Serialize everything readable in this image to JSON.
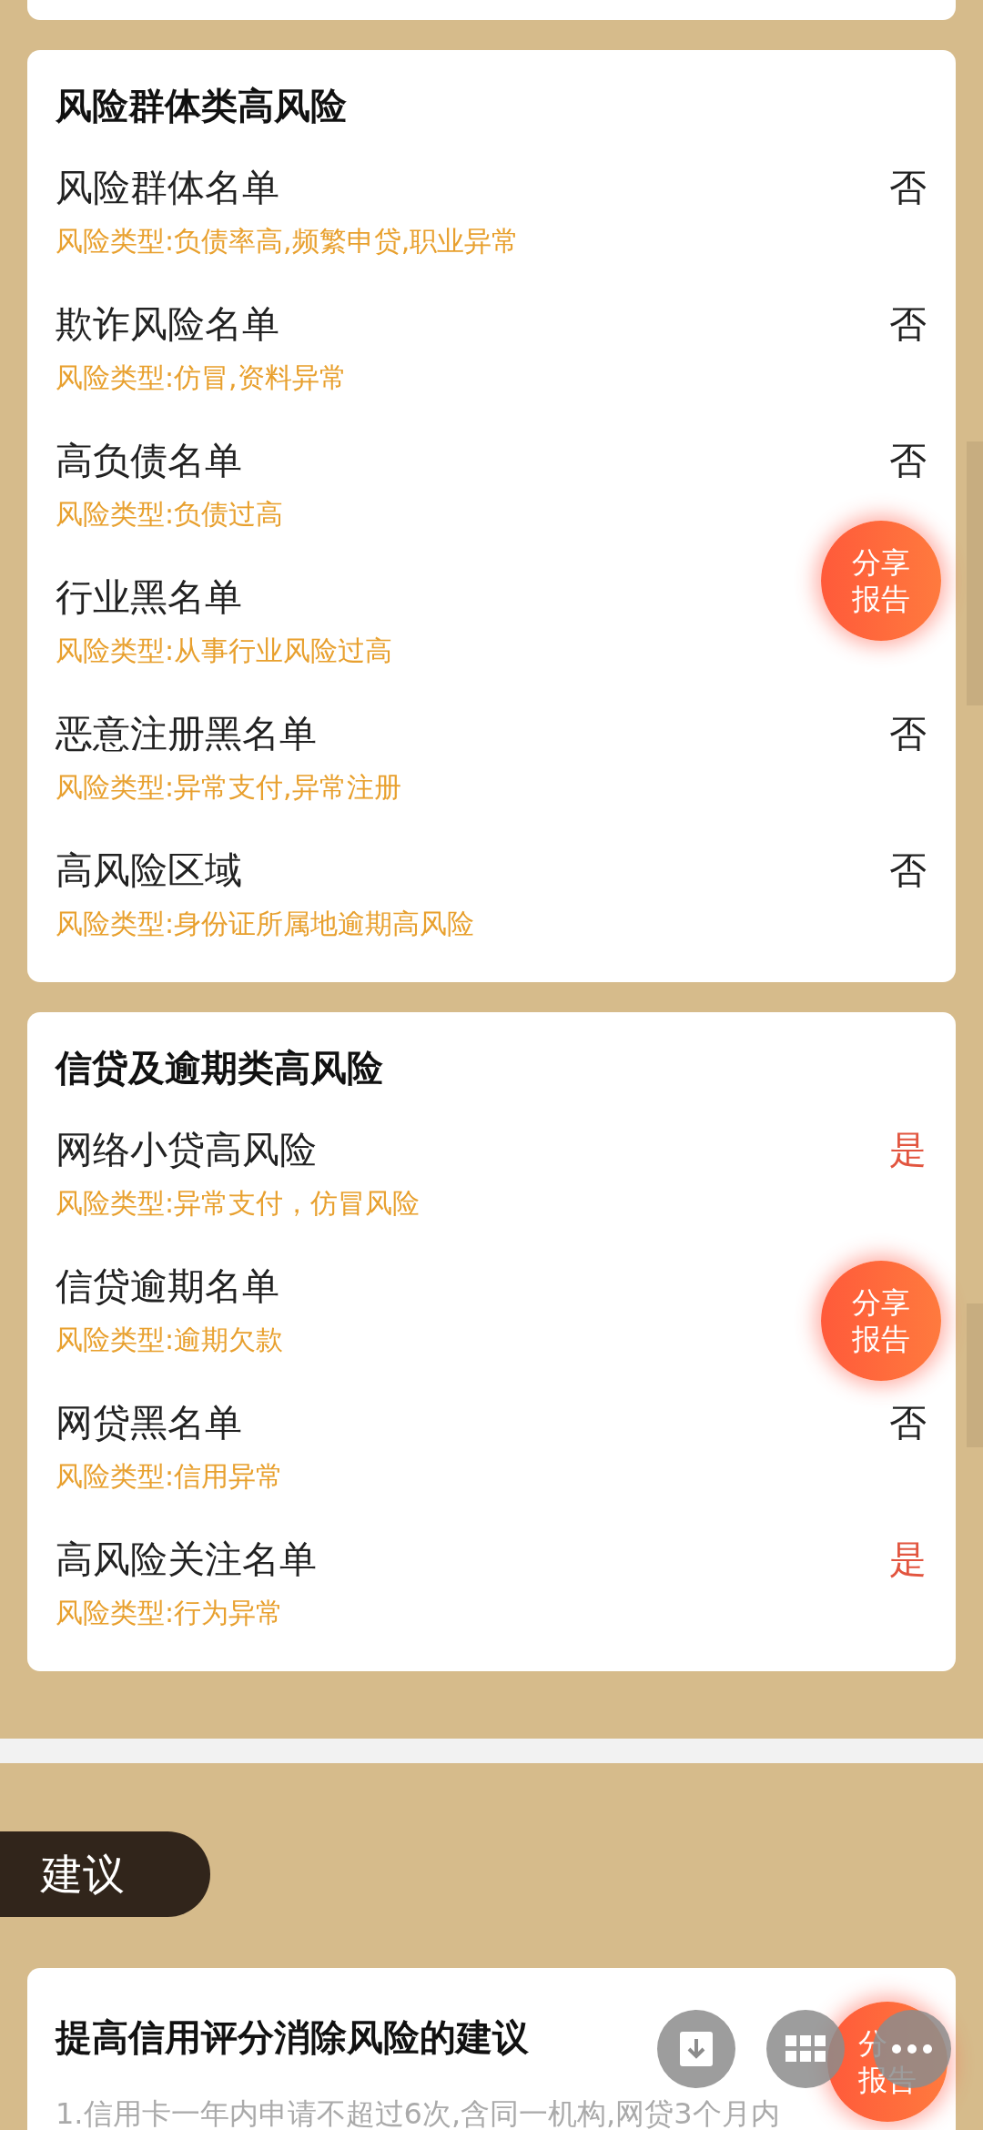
{
  "sections": [
    {
      "title": "风险群体类高风险",
      "items": [
        {
          "name": "风险群体名单",
          "risk_type": "风险类型:负债率高,频繁申贷,职业异常",
          "value": "否",
          "flagged": false
        },
        {
          "name": "欺诈风险名单",
          "risk_type": "风险类型:仿冒,资料异常",
          "value": "否",
          "flagged": false
        },
        {
          "name": "高负债名单",
          "risk_type": "风险类型:负债过高",
          "value": "否",
          "flagged": false
        },
        {
          "name": "行业黑名单",
          "risk_type": "风险类型:从事行业风险过高"
        },
        {
          "name": "恶意注册黑名单",
          "risk_type": "风险类型:异常支付,异常注册",
          "value": "否",
          "flagged": false
        },
        {
          "name": "高风险区域",
          "risk_type": "风险类型:身份证所属地逾期高风险",
          "value": "否",
          "flagged": false
        }
      ]
    },
    {
      "title": "信贷及逾期类高风险",
      "items": [
        {
          "name": "网络小贷高风险",
          "risk_type": "风险类型:异常支付，仿冒风险",
          "value": "是",
          "flagged": true
        },
        {
          "name": "信贷逾期名单",
          "risk_type": "风险类型:逾期欠款"
        },
        {
          "name": "网贷黑名单",
          "risk_type": "风险类型:信用异常",
          "value": "否",
          "flagged": false
        },
        {
          "name": "高风险关注名单",
          "risk_type": "风险类型:行为异常",
          "value": "是",
          "flagged": true
        }
      ]
    }
  ],
  "advice": {
    "tag": "建议",
    "title": "提高信用评分消除风险的建议",
    "text": "1.信用卡一年内申请不超过6次,含同一机构,网贷3个月内"
  },
  "share_buttons": [
    {
      "lines": [
        "分享",
        "报告"
      ]
    },
    {
      "lines": [
        "分享",
        "报告"
      ]
    },
    {
      "lines": [
        "分",
        "报告"
      ]
    }
  ]
}
